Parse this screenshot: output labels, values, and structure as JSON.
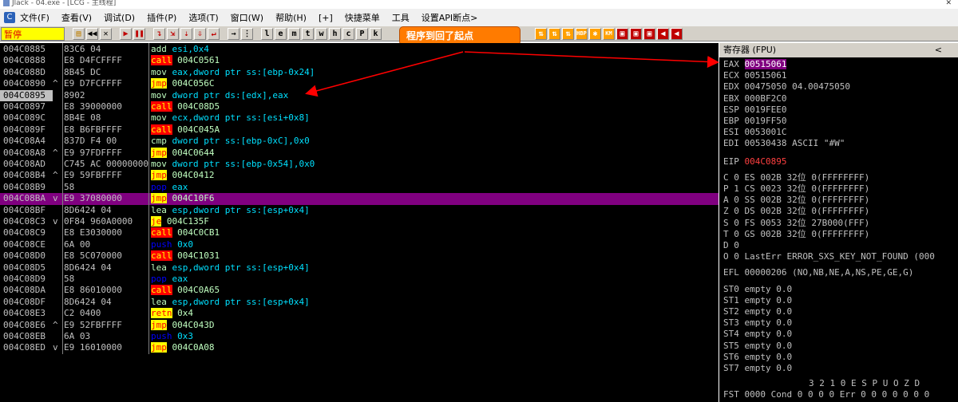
{
  "title": "Jlack - 04.exe - [LCG - 主线程]",
  "menu": [
    "文件(F)",
    "查看(V)",
    "调试(D)",
    "插件(P)",
    "选项(T)",
    "窗口(W)",
    "帮助(H)",
    "[+]",
    "快捷菜单",
    "工具",
    "设置API断点>"
  ],
  "status": "暂停",
  "toolbar_letters": [
    "l",
    "e",
    "m",
    "t",
    "w",
    "h",
    "c",
    "P",
    "k"
  ],
  "annotation": "程序到回了起点",
  "disasm": [
    {
      "addr": "004C0885",
      "jm": "",
      "hex": "83C6 04",
      "mn": "add",
      "op": "esi,0x4",
      "kind": "normal"
    },
    {
      "addr": "004C0888",
      "jm": "",
      "hex": "E8 D4FCFFFF",
      "mn": "call",
      "op": "004C0561",
      "kind": "call"
    },
    {
      "addr": "004C088D",
      "jm": "",
      "hex": "8B45 DC",
      "mn": "mov",
      "op": "eax,dword ptr ss:[ebp-0x24]",
      "kind": "normal"
    },
    {
      "addr": "004C0890",
      "jm": "^",
      "hex": "E9 D7FCFFFF",
      "mn": "jmp",
      "op": "004C056C",
      "kind": "jmp"
    },
    {
      "addr": "004C0895",
      "jm": "",
      "hex": "8902",
      "mn": "mov",
      "op": "dword ptr ds:[edx],eax",
      "kind": "normal",
      "cur": true
    },
    {
      "addr": "004C0897",
      "jm": "",
      "hex": "E8 39000000",
      "mn": "call",
      "op": "004C08D5",
      "kind": "call"
    },
    {
      "addr": "004C089C",
      "jm": "",
      "hex": "8B4E 08",
      "mn": "mov",
      "op": "ecx,dword ptr ss:[esi+0x8]",
      "kind": "normal"
    },
    {
      "addr": "004C089F",
      "jm": "",
      "hex": "E8 B6FBFFFF",
      "mn": "call",
      "op": "004C045A",
      "kind": "call"
    },
    {
      "addr": "004C08A4",
      "jm": "",
      "hex": "837D F4 00",
      "mn": "cmp",
      "op": "dword ptr ss:[ebp-0xC],0x0",
      "kind": "normal"
    },
    {
      "addr": "004C08A8",
      "jm": "^",
      "hex": "E9 97FDFFFF",
      "mn": "jmp",
      "op": "004C0644",
      "kind": "jmp"
    },
    {
      "addr": "004C08AD",
      "jm": "",
      "hex": "C745 AC 00000000",
      "mn": "mov",
      "op": "dword ptr ss:[ebp-0x54],0x0",
      "kind": "normal"
    },
    {
      "addr": "004C08B4",
      "jm": "^",
      "hex": "E9 59FBFFFF",
      "mn": "jmp",
      "op": "004C0412",
      "kind": "jmp"
    },
    {
      "addr": "004C08B9",
      "jm": "",
      "hex": "58",
      "mn": "pop",
      "op": "eax",
      "kind": "push"
    },
    {
      "addr": "004C08BA",
      "jm": "v",
      "hex": "E9 37080000",
      "mn": "jmp",
      "op": "004C10F6",
      "kind": "jmp",
      "hl": true
    },
    {
      "addr": "004C08BF",
      "jm": "",
      "hex": "8D6424 04",
      "mn": "lea",
      "op": "esp,dword ptr ss:[esp+0x4]",
      "kind": "normal"
    },
    {
      "addr": "004C08C3",
      "jm": "v",
      "hex": "0F84 960A0000",
      "mn": "je",
      "op": "004C135F",
      "kind": "jmp"
    },
    {
      "addr": "004C08C9",
      "jm": "",
      "hex": "E8 E3030000",
      "mn": "call",
      "op": "004C0CB1",
      "kind": "call"
    },
    {
      "addr": "004C08CE",
      "jm": "",
      "hex": "6A 00",
      "mn": "push",
      "op": "0x0",
      "kind": "push"
    },
    {
      "addr": "004C08D0",
      "jm": "",
      "hex": "E8 5C070000",
      "mn": "call",
      "op": "004C1031",
      "kind": "call"
    },
    {
      "addr": "004C08D5",
      "jm": "",
      "hex": "8D6424 04",
      "mn": "lea",
      "op": "esp,dword ptr ss:[esp+0x4]",
      "kind": "normal"
    },
    {
      "addr": "004C08D9",
      "jm": "",
      "hex": "58",
      "mn": "pop",
      "op": "eax",
      "kind": "push"
    },
    {
      "addr": "004C08DA",
      "jm": "",
      "hex": "E8 86010000",
      "mn": "call",
      "op": "004C0A65",
      "kind": "call"
    },
    {
      "addr": "004C08DF",
      "jm": "",
      "hex": "8D6424 04",
      "mn": "lea",
      "op": "esp,dword ptr ss:[esp+0x4]",
      "kind": "normal"
    },
    {
      "addr": "004C08E3",
      "jm": "",
      "hex": "C2 0400",
      "mn": "retn",
      "op": "0x4",
      "kind": "jmp"
    },
    {
      "addr": "004C08E6",
      "jm": "^",
      "hex": "E9 52FBFFFF",
      "mn": "jmp",
      "op": "004C043D",
      "kind": "jmp"
    },
    {
      "addr": "004C08EB",
      "jm": "",
      "hex": "6A 03",
      "mn": "push",
      "op": "0x3",
      "kind": "push"
    },
    {
      "addr": "004C08ED",
      "jm": "v",
      "hex": "E9 16010000",
      "mn": "jmp",
      "op": "004C0A08",
      "kind": "jmp"
    }
  ],
  "registers_title": "寄存器 (FPU)",
  "registers": [
    {
      "name": "EAX",
      "value": "00515061",
      "note": ""
    },
    {
      "name": "ECX",
      "value": "00515061",
      "note": ""
    },
    {
      "name": "EDX",
      "value": "00475050",
      "note": "04.00475050"
    },
    {
      "name": "EBX",
      "value": "000BF2C0",
      "note": ""
    },
    {
      "name": "ESP",
      "value": "0019FEE0",
      "note": ""
    },
    {
      "name": "EBP",
      "value": "0019FF50",
      "note": ""
    },
    {
      "name": "ESI",
      "value": "0053001C",
      "note": ""
    },
    {
      "name": "EDI",
      "value": "00530438",
      "note": "ASCII \"#W\""
    }
  ],
  "eip": {
    "name": "EIP",
    "value": "004C0895"
  },
  "flags": [
    "C 0  ES 002B 32位 0(FFFFFFFF)",
    "P 1  CS 0023 32位 0(FFFFFFFF)",
    "A 0  SS 002B 32位 0(FFFFFFFF)",
    "Z 0  DS 002B 32位 0(FFFFFFFF)",
    "S 0  FS 0053 32位 27B000(FFF)",
    "T 0  GS 002B 32位 0(FFFFFFFF)",
    "D 0",
    "O 0  LastErr ERROR_SXS_KEY_NOT_FOUND (000"
  ],
  "efl": "EFL 00000206 (NO,NB,NE,A,NS,PE,GE,G)",
  "fpu": [
    "ST0 empty 0.0",
    "ST1 empty 0.0",
    "ST2 empty 0.0",
    "ST3 empty 0.0",
    "ST4 empty 0.0",
    "ST5 empty 0.0",
    "ST6 empty 0.0",
    "ST7 empty 0.0"
  ],
  "fpu_footer1": "3 2 1 0      E S P U O Z D",
  "fpu_footer2": "FST 0000  Cond 0 0 0 0  Err 0 0 0 0 0 0 0"
}
